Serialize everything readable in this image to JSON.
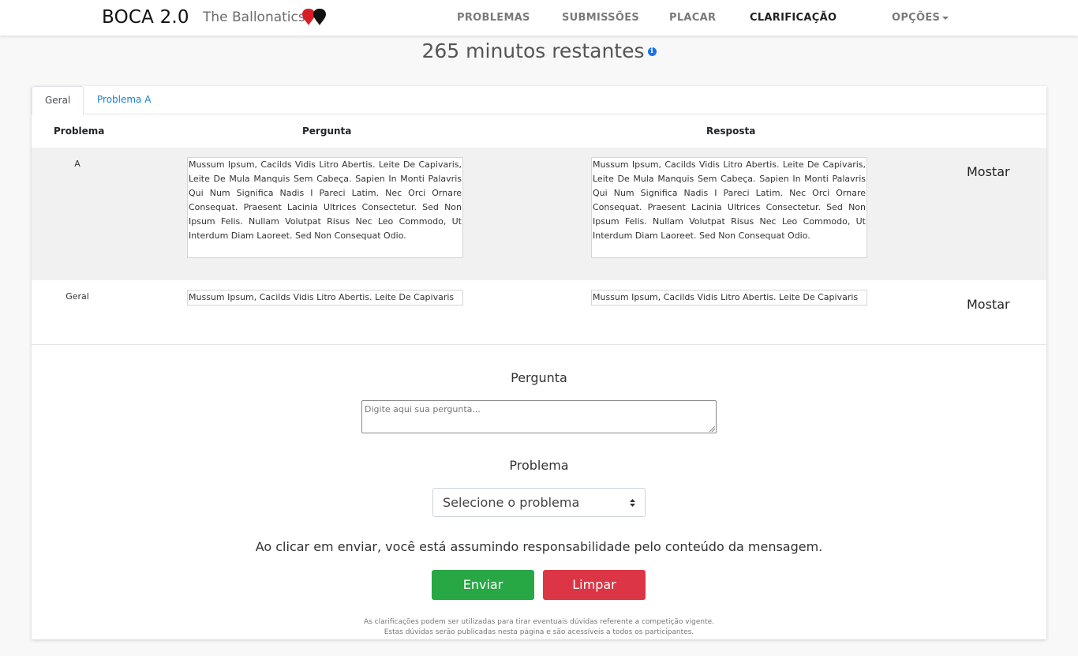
{
  "navbar": {
    "brand": "BOCA 2.0",
    "team": "The Ballonatics",
    "balloon_colors": [
      "#d61f26",
      "#111111"
    ],
    "items": [
      {
        "label": "PROBLEMAS",
        "active": false
      },
      {
        "label": "SUBMISSÕES",
        "active": false
      },
      {
        "label": "PLACAR",
        "active": false
      },
      {
        "label": "CLARIFICAÇÃO",
        "active": true
      },
      {
        "label": "OPÇÕES",
        "dropdown": true
      }
    ]
  },
  "timer": {
    "text": "265 minutos restantes",
    "info_icon": "info-icon"
  },
  "tabs": [
    {
      "label": "Geral",
      "active": true
    },
    {
      "label": "Problema A",
      "active": false
    }
  ],
  "table": {
    "headers": {
      "problem": "Problema",
      "question": "Pergunta",
      "answer": "Resposta"
    },
    "rows": [
      {
        "problem": "A",
        "question": "Mussum Ipsum, Cacilds Vidis Litro Abertis. Leite De Capivaris, Leite De Mula Manquis Sem Cabeça. Sapien In Monti Palavris Qui Num Significa Nadis I Pareci Latim. Nec Orci Ornare Consequat. Praesent Lacinia Ultrices Consectetur. Sed Non Ipsum Felis. Nullam Volutpat Risus Nec Leo Commodo, Ut Interdum Diam Laoreet. Sed Non Consequat Odio.",
        "answer": "Mussum Ipsum, Cacilds Vidis Litro Abertis. Leite De Capivaris, Leite De Mula Manquis Sem Cabeça. Sapien In Monti Palavris Qui Num Significa Nadis I Pareci Latim. Nec Orci Ornare Consequat. Praesent Lacinia Ultrices Consectetur. Sed Non Ipsum Felis. Nullam Volutpat Risus Nec Leo Commodo, Ut Interdum Diam Laoreet. Sed Non Consequat Odio.",
        "action": "Mostar"
      },
      {
        "problem": "Geral",
        "question": "Mussum Ipsum, Cacilds Vidis Litro Abertis. Leite De Capivaris",
        "answer": "Mussum Ipsum, Cacilds Vidis Litro Abertis. Leite De Capivaris",
        "action": "Mostar"
      }
    ]
  },
  "form": {
    "question_label": "Pergunta",
    "question_placeholder": "Digite aqui sua pergunta...",
    "problem_label": "Problema",
    "problem_select": "Selecione o problema",
    "disclaimer": "Ao clicar em enviar, você está assumindo responsabilidade pelo conteúdo da mensagem.",
    "send_label": "Enviar",
    "clear_label": "Limpar",
    "footnote_line1": "As clarificações podem ser utilizadas para tirar eventuais dúvidas referente a competição vigente.",
    "footnote_line2": "Estas dúvidas serão publicadas nesta página e são acessíveis a todos os participantes."
  },
  "colors": {
    "send": "#28a745",
    "clear": "#dc3545",
    "link": "#1a7fd0",
    "info": "#1a73e8"
  }
}
